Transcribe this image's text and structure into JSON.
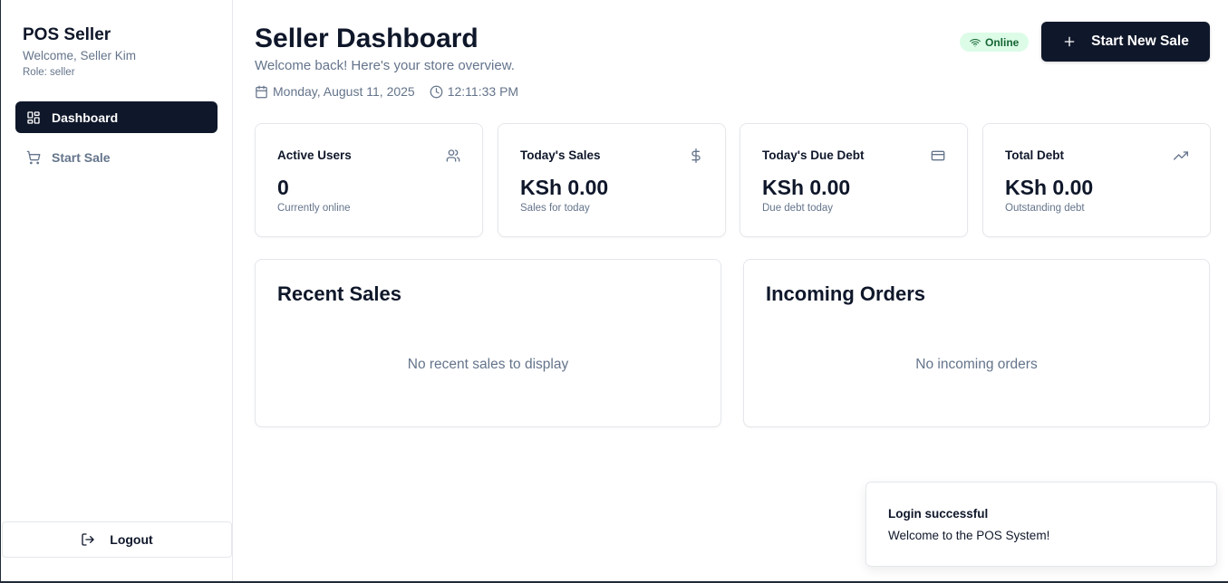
{
  "sidebar": {
    "title": "POS Seller",
    "welcome": "Welcome, Seller Kim",
    "role": "Role: seller",
    "items": [
      {
        "label": "Dashboard",
        "icon": "dashboard-grid-icon",
        "active": true
      },
      {
        "label": "Start Sale",
        "icon": "shopping-cart-icon",
        "active": false
      }
    ],
    "logout_label": "Logout"
  },
  "header": {
    "title": "Seller Dashboard",
    "subtitle": "Welcome back! Here's your store overview.",
    "date": "Monday, August 11, 2025",
    "time": "12:11:33 PM",
    "status": "Online",
    "new_sale_label": "Start New Sale"
  },
  "stats": [
    {
      "label": "Active Users",
      "value": "0",
      "caption": "Currently online",
      "icon": "users-icon"
    },
    {
      "label": "Today's Sales",
      "value": "KSh 0.00",
      "caption": "Sales for today",
      "icon": "dollar-icon"
    },
    {
      "label": "Today's Due Debt",
      "value": "KSh 0.00",
      "caption": "Due debt today",
      "icon": "credit-card-icon"
    },
    {
      "label": "Total Debt",
      "value": "KSh 0.00",
      "caption": "Outstanding debt",
      "icon": "trending-up-icon"
    }
  ],
  "panels": {
    "recent_sales": {
      "title": "Recent Sales",
      "empty": "No recent sales to display"
    },
    "incoming_orders": {
      "title": "Incoming Orders",
      "empty": "No incoming orders"
    }
  },
  "toast": {
    "title": "Login successful",
    "description": "Welcome to the POS System!"
  },
  "colors": {
    "primary": "#0f172a",
    "muted_text": "#64748b",
    "border": "#e5e7eb",
    "online_bg": "#dcfce7",
    "online_text": "#166534"
  }
}
